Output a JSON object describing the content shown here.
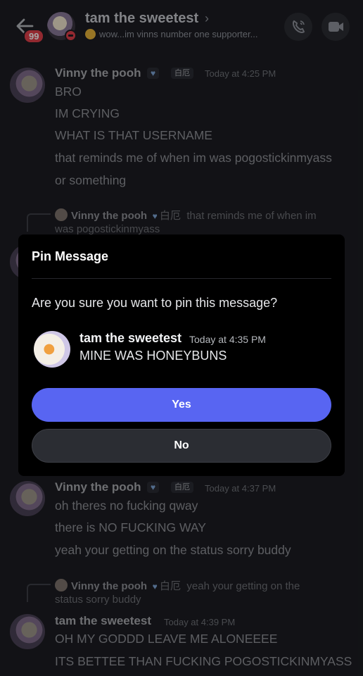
{
  "header": {
    "title": "tam the sweetest",
    "status": "wow...im vinns number one supporter...",
    "unread_badge": "99"
  },
  "messages": [
    {
      "author": "Vinny the pooh",
      "tag": "白厄",
      "time": "Today at 4:25 PM",
      "lines": [
        "BRO",
        "IM CRYING",
        "WHAT IS THAT USERNAME",
        "that reminds me of when im was pogostickinmyass",
        "or something"
      ]
    },
    {
      "reply_author": "Vinny the pooh",
      "reply_tag": "白厄",
      "reply_line1": "that reminds me of when im",
      "reply_line2": "was pogostickinmyass"
    },
    {
      "author": "Vinny the pooh",
      "tag": "白厄",
      "time": "Today at 4:37 PM",
      "lines": [
        "oh theres no fucking qway",
        "there is NO FUCKING WAY",
        "yeah your getting on the status sorry buddy"
      ]
    },
    {
      "reply_author": "Vinny the pooh",
      "reply_tag": "白厄",
      "reply_line1": "yeah your getting on the",
      "reply_line2": "status sorry buddy"
    },
    {
      "author": "tam the sweetest",
      "time": "Today at 4:39 PM",
      "lines": [
        "OH MY GODDD LEAVE ME ALONEEEE",
        "ITS BETTEE THAN FUCKING POGOSTICKINMYASS"
      ]
    }
  ],
  "modal": {
    "title": "Pin Message",
    "question": "Are you sure you want to pin this message?",
    "preview_author": "tam the sweetest",
    "preview_time": "Today at 4:35 PM",
    "preview_text": "MINE WAS HONEYBUNS",
    "yes_label": "Yes",
    "no_label": "No"
  },
  "colors": {
    "accent": "#5865f2",
    "background": "#1c1d22",
    "badge": "#e0404a"
  }
}
